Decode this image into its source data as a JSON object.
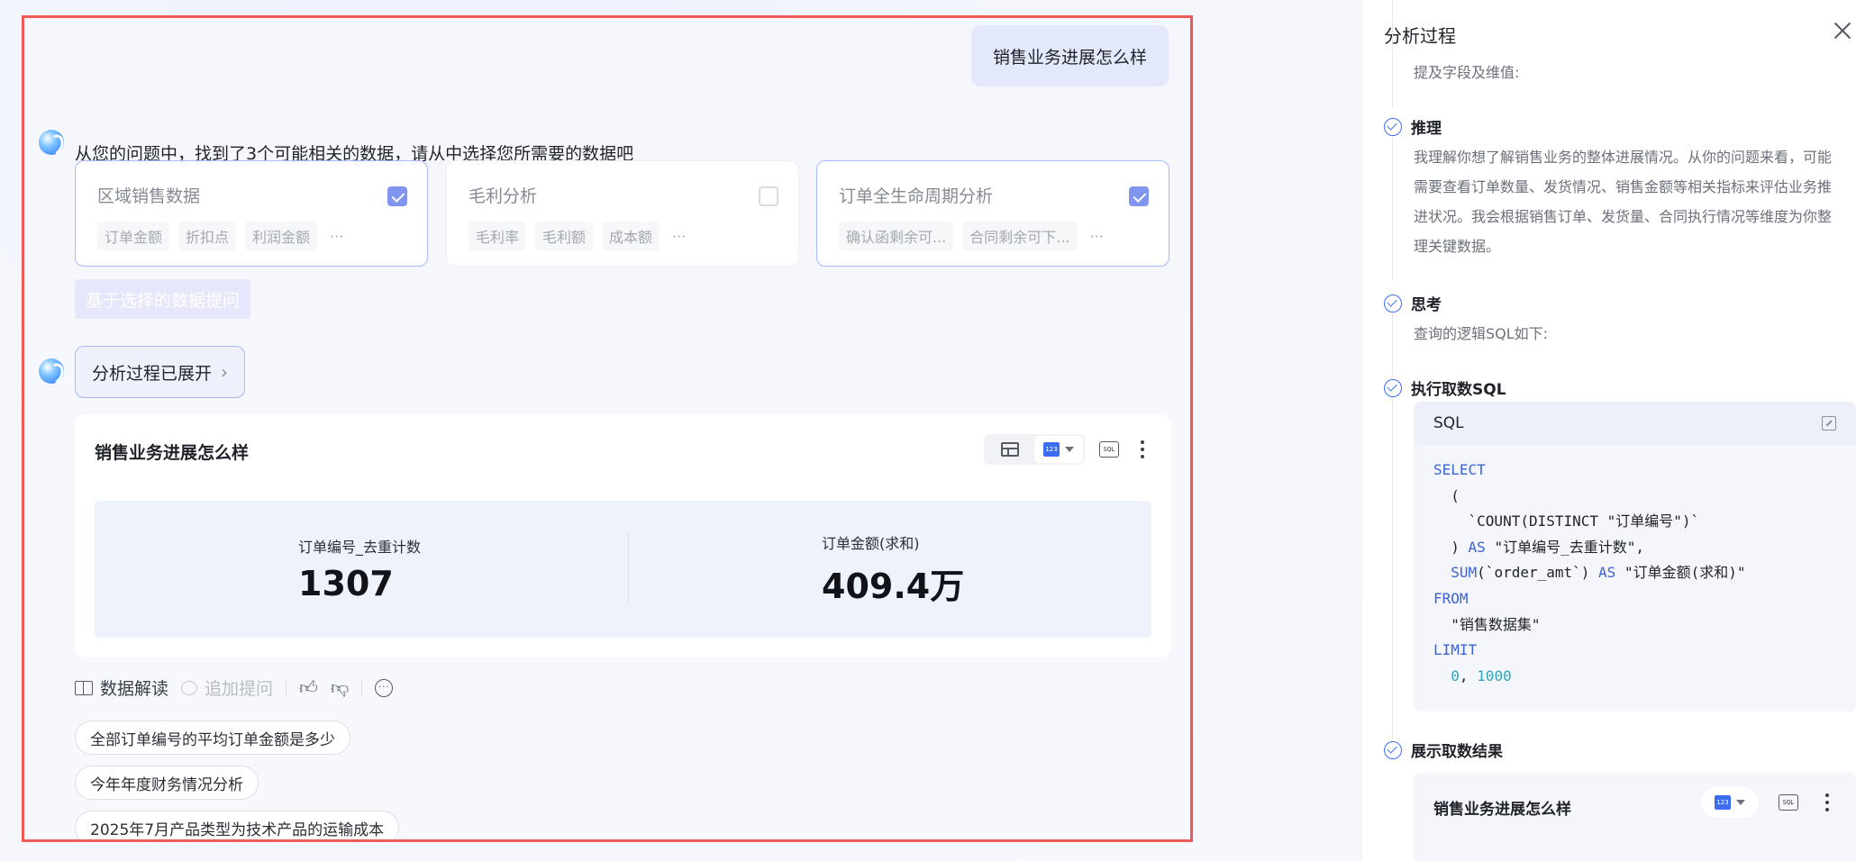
{
  "chat": {
    "user_question": "销售业务进展怎么样",
    "intro_text": "从您的问题中，找到了3个可能相关的数据，请从中选择您所需要的数据吧",
    "datasets": [
      {
        "title": "区域销售数据",
        "selected": true,
        "tags": [
          "订单金额",
          "折扣点",
          "利润金额"
        ],
        "more": "···"
      },
      {
        "title": "毛利分析",
        "selected": false,
        "tags": [
          "毛利率",
          "毛利额",
          "成本额"
        ],
        "more": "···"
      },
      {
        "title": "订单全生命周期分析",
        "selected": true,
        "tags": [
          "确认函剩余可...",
          "合同剩余可下..."
        ],
        "more": "···"
      }
    ],
    "ask_button": "基于选择的数据提问",
    "analysis_toggle": "分析过程已展开",
    "result": {
      "title": "销售业务进展怎么样",
      "kpis": [
        {
          "label": "订单编号_去重计数",
          "value": "1307"
        },
        {
          "label": "订单金额(求和)",
          "value": "409.4万"
        }
      ]
    },
    "actions": {
      "interpret": "数据解读",
      "follow_up": "追加提问"
    },
    "suggestions": [
      "全部订单编号的平均订单金额是多少",
      "今年年度财务情况分析",
      "2025年7月产品类型为技术产品的运输成本"
    ]
  },
  "panel": {
    "title": "分析过程",
    "field_hint": "提及字段及维值:",
    "steps": {
      "reasoning": "推理",
      "reasoning_text": "我理解你想了解销售业务的整体进展情况。从你的问题来看，可能需要查看订单数量、发货情况、销售金额等相关指标来评估业务推进状况。我会根据销售订单、发货量、合同执行情况等维度为你整理关键数据。",
      "thinking": "思考",
      "thinking_text": "查询的逻辑SQL如下:",
      "exec_sql": "执行取数SQL",
      "show_result": "展示取数结果"
    },
    "sql": {
      "header": "SQL",
      "lines": {
        "l1": "SELECT",
        "l2": "  (",
        "l3": "    `COUNT(DISTINCT \"订单编号\")`",
        "l4_kw": "AS",
        "l4": "\"订单编号_去重计数\",",
        "l5_fn": "SUM",
        "l5_mid": "(`order_amt`) ",
        "l5_kw": "AS",
        "l5": "\"订单金额(求和)\"",
        "l6": "FROM",
        "l7": "  \"销售数据集\"",
        "l8": "LIMIT",
        "l9_a": "0",
        "l9_b": "1000"
      }
    },
    "mini_result_title": "销售业务进展怎么样"
  },
  "icons": {
    "bot": "assistant-logo-icon",
    "table": "table-icon",
    "number": "number-card-icon",
    "sql": "sql-icon",
    "more": "more-vertical-icon",
    "close": "close-icon",
    "check_step": "check-circle-icon"
  },
  "colors": {
    "highlight_frame": "#ee5b54",
    "accent": "#3a6df0",
    "checkbox": "#7f95ef",
    "sql_keyword": "#3a63d8",
    "sql_number": "#2aa8c0"
  }
}
